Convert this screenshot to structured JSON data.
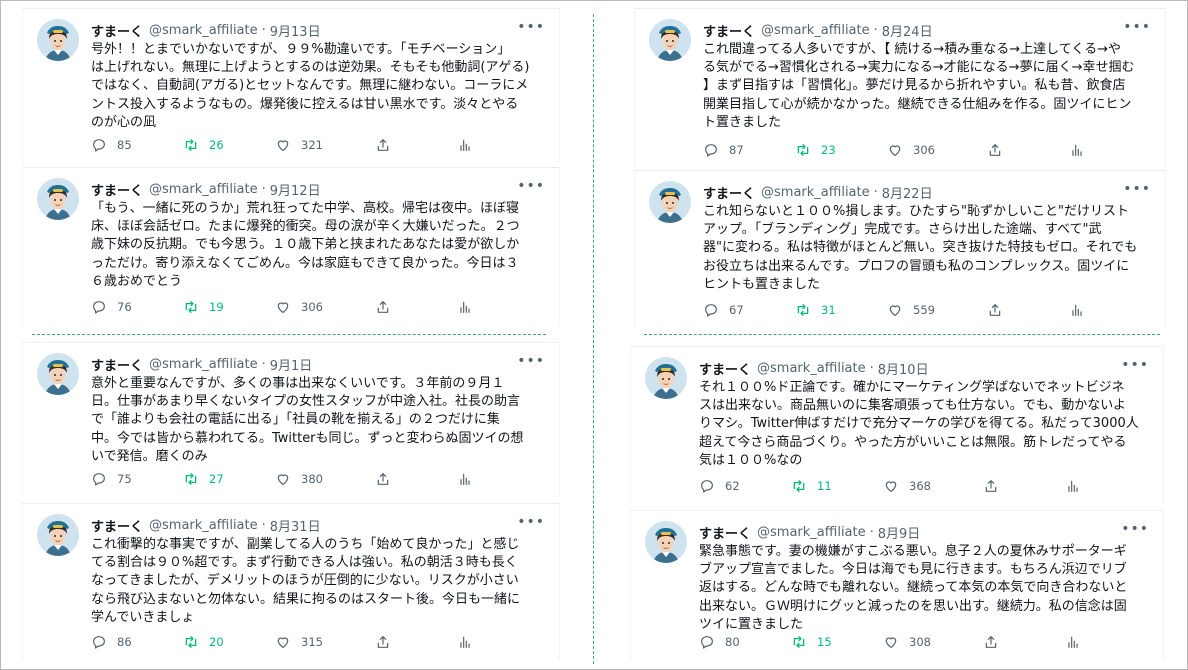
{
  "tweets": [
    {
      "name": "すまーく",
      "handle": "@smark_affiliate",
      "sep": "·",
      "date": "9月13日",
      "text": "号外！！とまでいかないですが、９９%勘違いです。「モチベーション」\nは上げれない。無理に上げようとするのは逆効果。そもそも他動詞(アゲる)\nではなく、自動詞(アガる)とセットなんです。無理に継わない。コーラにメ\nントス投入するようなもの。爆発後に控えるは甘い黒水です。淡々とやる\nのが心の凪",
      "reply": "85",
      "retweet": "26",
      "like": "321"
    },
    {
      "name": "すまーく",
      "handle": "@smark_affiliate",
      "sep": "·",
      "date": "9月12日",
      "text": "「もう、一緒に死のうか」荒れ狂ってた中学、高校。帰宅は夜中。ほぼ寝\n床、ほぼ会話ゼロ。たまに爆発的衝突。母の涙が辛く大嫌いだった。２つ\n歳下妹の反抗期。でも今思う。１０歳下弟と挟まれたあなたは愛が欲しか\nっただけ。寄り添えなくてごめん。今は家庭もできて良かった。今日は３\n６歳おめでとう",
      "reply": "76",
      "retweet": "19",
      "like": "306"
    },
    {
      "name": "すまーく",
      "handle": "@smark_affiliate",
      "sep": "·",
      "date": "9月1日",
      "text": "意外と重要なんですが、多くの事は出来なくいいです。３年前の９月１\n日。仕事があまり早くないタイプの女性スタッフが中途入社。社長の助言\nで「誰よりも会社の電話に出る」「社員の靴を揃える」の２つだけに集\n中。今では皆から慕われてる。Twitterも同じ。ずっと変わらぬ固ツイの想\nいで発信。磨くのみ",
      "reply": "75",
      "retweet": "27",
      "like": "380"
    },
    {
      "name": "すまーく",
      "handle": "@smark_affiliate",
      "sep": "·",
      "date": "8月31日",
      "text": "これ衝撃的な事実ですが、副業してる人のうち「始めて良かった」と感じ\nてる割合は９０%超です。まず行動できる人は強い。私の朝活３時も長く\nなってきましたが、デメリットのほうが圧倒的に少ない。リスクが小さい\nなら飛び込まないと勿体ない。結果に拘るのはスタート後。今日も一緒に\n学んでいきましょ",
      "reply": "86",
      "retweet": "20",
      "like": "315"
    },
    {
      "name": "すまーく",
      "handle": "@smark_affiliate",
      "sep": "·",
      "date": "8月24日",
      "text": "これ間違ってる人多いですが、【 続ける→積み重なる→上達してくる→や\nる気がでる→習慣化される→実力になる→才能になる→夢に届く→幸せ掴む\n】まず目指すは「習慣化」。夢だけ見るから折れやすい。私も昔、飲食店\n開業目指して心が続かなかった。継続できる仕組みを作る。固ツイにヒン\nト置きました",
      "reply": "87",
      "retweet": "23",
      "like": "306"
    },
    {
      "name": "すまーく",
      "handle": "@smark_affiliate",
      "sep": "·",
      "date": "8月22日",
      "text": "これ知らないと１００%損します。ひたすら\"恥ずかしいこと\"だけリスト\nアップ。「ブランディング」完成です。さらけ出した途端、すべて\"武\n器\"に変わる。私は特徴がほとんど無い。突き抜けた特技もゼロ。それでも\nお役立ちは出来るんです。プロフの冒頭も私のコンプレックス。固ツイに\nヒントも置きました",
      "reply": "67",
      "retweet": "31",
      "like": "559"
    },
    {
      "name": "すまーく",
      "handle": "@smark_affiliate",
      "sep": "·",
      "date": "8月10日",
      "text": "それ１００%ド正論です。確かにマーケティング学ばないでネットビジネ\nスは出来ない。商品無いのに集客頑張っても仕方ない。でも、動かないよ\nりマシ。Twitter伸ばすだけで充分マーケの学びを得てる。私だって3000人\n超えて今さら商品づくり。やった方がいいことは無限。筋トレだってやる\n気は１００%なの",
      "reply": "62",
      "retweet": "11",
      "like": "368"
    },
    {
      "name": "すまーく",
      "handle": "@smark_affiliate",
      "sep": "·",
      "date": "8月9日",
      "text": "緊急事態です。妻の機嫌がすこぶる悪い。息子２人の夏休みサポーターギ\nブアップ宣言でました。今日は海でも見に行きます。もちろん浜辺でリブ\n返はする。どんな時でも離れない。継続って本気の本気で向き合わないと\n出来ない。ＧＷ明けにグッと減ったのを思い出す。継続力。私の信念は固\nツイに置きました",
      "reply": "80",
      "retweet": "15",
      "like": "308"
    }
  ],
  "icons": {
    "reply": "reply-icon",
    "retweet": "retweet-icon",
    "like": "like-icon",
    "share": "share-icon",
    "analytics": "analytics-icon",
    "more": "more-icon"
  },
  "colors": {
    "retweet_active": "#00ba7c",
    "divider": "#3fa86b",
    "muted": "#536471"
  }
}
